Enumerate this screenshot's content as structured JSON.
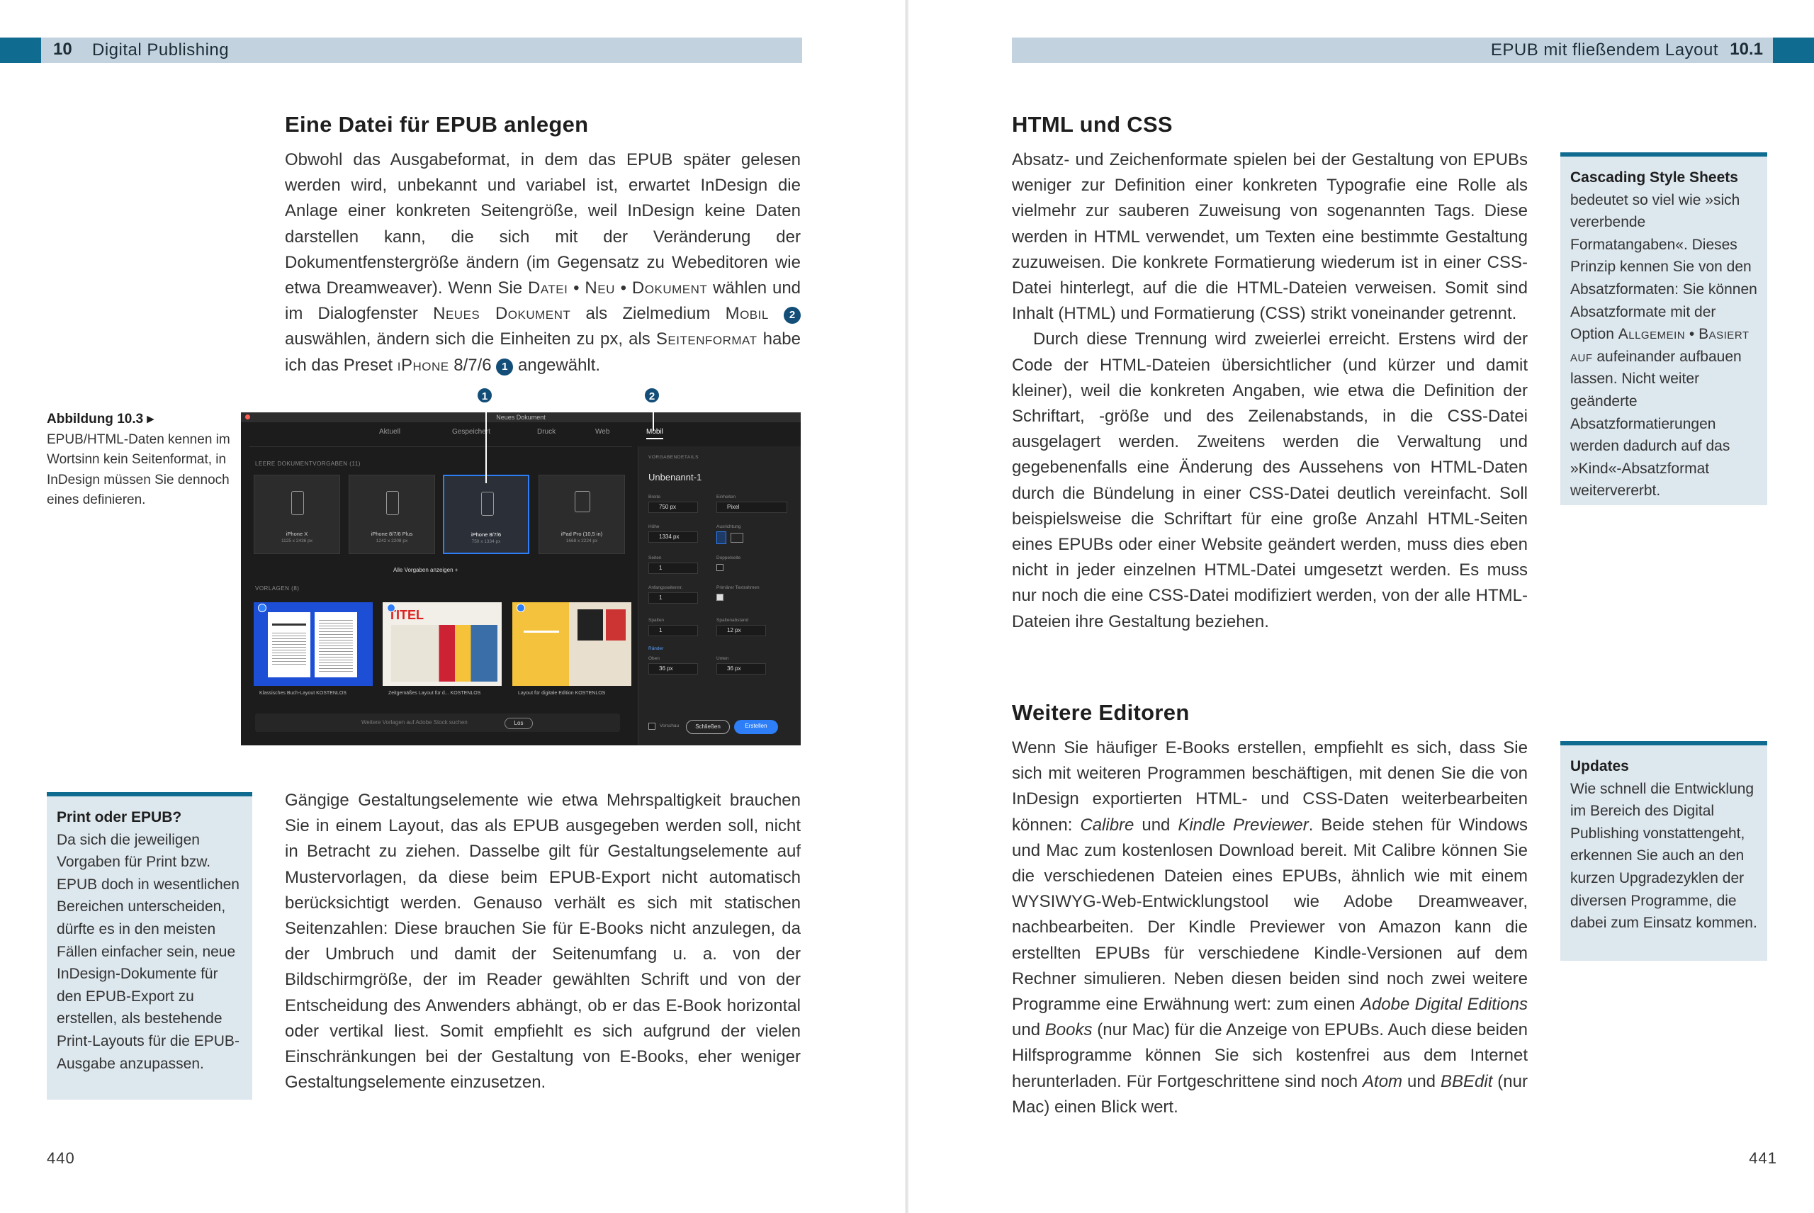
{
  "left_page": {
    "header": {
      "chapter_number": "10",
      "chapter_title": "Digital Publishing"
    },
    "folio": "440",
    "section_title": "Eine Datei für EPUB anlegen",
    "paragraph1": {
      "t1": "Obwohl das Ausgabeformat, in dem das EPUB später gelesen werden wird, unbekannt und variabel ist, erwartet InDesign die Anlage einer konkreten Seitengröße, weil InDesign keine Daten darstellen kann, die sich mit der Veränderung der Dokumentfenstergröße ändern (im Gegensatz zu Webeditoren wie etwa Dreamweaver). Wenn Sie ",
      "sc1": "Datei",
      "sep1": " • ",
      "sc2": "Neu",
      "sep2": " • ",
      "sc3": "Dokument",
      "t2": " wählen und im Dialogfenster ",
      "sc4": "Neues Dokument",
      "t3": " als Zielmedium ",
      "sc5": "Mobil",
      "callout2": "2",
      "t4": " auswählen, ändern sich die Einheiten zu px, als ",
      "sc6": "Seitenformat",
      "t5": " habe ich das Preset ",
      "sc7": "iPhone",
      "t6": " 8/7/6 ",
      "callout1": "1",
      "t7": " angewählt."
    },
    "figure_caption": {
      "title": "Abbildung 10.3 ▸",
      "text": "EPUB/HTML-Daten kennen im Wortsinn kein Seitenformat, in InDesign müssen Sie dennoch eines definieren."
    },
    "figure": {
      "window_title": "Neues Dokument",
      "tabs": [
        "Aktuell",
        "Gespeichert",
        "Druck",
        "Web",
        "Mobil"
      ],
      "active_tab": "Mobil",
      "presets_label": "LEERE DOKUMENTVORGABEN  (11)",
      "presets": [
        {
          "name": "iPhone X",
          "size": "1125 x 2436 px"
        },
        {
          "name": "iPhone 8/7/6 Plus",
          "size": "1242 x 2208 px"
        },
        {
          "name": "iPhone 8/7/6",
          "size": "750 x 1334 px"
        },
        {
          "name": "iPad Pro (10,5 in)",
          "size": "1668 x 2224 px"
        }
      ],
      "show_all": "Alle Vorgaben anzeigen  +",
      "templates_label": "VORLAGEN  (8)",
      "templates": [
        "Klassisches Buch-Layout  KOSTENLOS",
        "Zeitgemäßes Layout für d...  KOSTENLOS",
        "Layout für digitale Edition  KOSTENLOS"
      ],
      "search_placeholder": "Weitere Vorlagen auf Adobe Stock suchen",
      "search_button": "Los",
      "panel": {
        "header": "VORGABENDETAILS",
        "doc_name": "Unbenannt-1",
        "width_label": "Breite",
        "width_value": "750 px",
        "unit_label": "Einheiten",
        "unit_value": "Pixel",
        "height_label": "Höhe",
        "height_value": "1334 px",
        "orientation_label": "Ausrichtung",
        "pages_label": "Seiten",
        "pages_value": "1",
        "facing_label": "Doppelseite",
        "start_label": "Anfangsseitennr.",
        "start_value": "1",
        "primary_label": "Primärer Textrahmen",
        "columns_label": "Spalten",
        "columns_value": "1",
        "gutter_label": "Spaltenabstand",
        "gutter_value": "12 px",
        "margins_label": "Ränder",
        "top_label": "Oben",
        "top_value": "36 px",
        "bottom_label": "Unten",
        "bottom_value": "36 px",
        "preview_label": "Vorschau",
        "close_button": "Schließen",
        "create_button": "Erstellen"
      },
      "callout1": "1",
      "callout2": "2",
      "tpl_title": "TITEL"
    },
    "marginbox": {
      "title": "Print oder EPUB?",
      "text": "Da sich die jeweiligen Vorgaben für Print bzw. EPUB doch in wesentlichen Bereichen unterscheiden, dürfte es in den meisten Fällen einfacher sein, neue InDesign-Dokumente für den EPUB-Export zu erstellen, als bestehende Print-Layouts für die EPUB-Ausgabe anzupassen."
    },
    "paragraph2": "Gängige Gestaltungselemente wie etwa Mehrspaltigkeit brauchen Sie in einem Layout, das als EPUB ausgegeben werden soll, nicht in Betracht zu ziehen. Dasselbe gilt für Gestaltungselemente auf Mustervorlagen, da diese beim EPUB-Export nicht automatisch berücksichtigt werden. Genauso verhält es sich mit statischen Seitenzahlen: Diese brauchen Sie für E-Books nicht anzulegen, da der Umbruch und damit der Seitenumfang u. a. von der Bildschirmgröße, der im Reader gewählten Schrift und von der Entscheidung des Anwenders abhängt, ob er das E-Book horizontal oder vertikal liest. Somit empfiehlt es sich aufgrund der vielen Einschränkungen bei der Gestaltung von E-Books, eher weniger Gestaltungselemente einzusetzen."
  },
  "right_page": {
    "header": {
      "section_title": "EPUB mit fließendem Layout",
      "section_number": "10.1"
    },
    "folio": "441",
    "section1_title": "HTML und CSS",
    "section1_p1": "Absatz- und Zeichenformate spielen bei der Gestaltung von EPUBs weniger zur Definition einer konkreten Typografie eine Rolle als vielmehr zur sauberen Zuweisung von sogenannten Tags. Diese werden in HTML verwendet, um Texten eine bestimmte Gestaltung zuzuweisen. Die konkrete Formatierung wiederum ist in einer CSS-Datei hinterlegt, auf die die HTML-Dateien verweisen. Somit sind Inhalt (HTML) und Formatierung (CSS) strikt voneinander getrennt.",
    "section1_p2": "Durch diese Trennung wird zweierlei erreicht. Erstens wird der Code der HTML-Dateien übersichtlicher (und kürzer und damit kleiner), weil die konkreten Angaben, wie etwa die Definition der Schriftart, -größe und des Zeilenabstands, in die CSS-Datei ausgelagert werden. Zweitens werden die Verwaltung und gegebenenfalls eine Änderung des Aussehens von HTML-Daten durch die Bündelung in einer CSS-Datei deutlich vereinfacht. Soll beispielsweise die Schriftart für eine große Anzahl HTML-Seiten eines EPUBs oder einer Website geändert werden, muss dies eben nicht in jeder einzelnen HTML-Datei umgesetzt werden. Es muss nur noch die eine CSS-Datei modifiziert werden, von der alle HTML-Dateien ihre Gestaltung beziehen.",
    "section2_title": "Weitere Editoren",
    "section2_p": {
      "t1": "Wenn Sie häufiger E-Books erstellen, empfiehlt es sich, dass Sie sich mit weiteren Programmen beschäftigen, mit denen Sie die von InDesign exportierten HTML- und CSS-Daten weiterbearbeiten können: ",
      "e1": "Calibre",
      "t2": " und ",
      "e2": "Kindle Previewer",
      "t3": ". Beide stehen für Windows und Mac zum kostenlosen Download bereit. Mit Calibre können Sie die verschiedenen Dateien eines EPUBs, ähnlich wie mit einem WYSIWYG-Web-Entwicklungstool wie Adobe Dreamweaver, nachbearbeiten. Der Kindle Previewer von Amazon kann die erstellten EPUBs für verschiedene Kindle-Versionen auf dem Rechner simulieren. Neben diesen beiden sind noch zwei weitere Programme eine Erwähnung wert: zum einen ",
      "e3": "Adobe Digital Editions",
      "t4": " und ",
      "e4": "Books",
      "t5": " (nur Mac) für die Anzeige von EPUBs. Auch diese beiden Hilfsprogramme können Sie sich kostenfrei aus dem Internet herunterladen. Für Fortgeschrittene sind noch ",
      "e5": "Atom",
      "t6": " und ",
      "e6": "BBEdit",
      "t7": " (nur Mac) einen Blick wert."
    },
    "marginbox1": {
      "title": "Cascading Style Sheets",
      "t1": "bedeutet so viel wie »sich vererbende Formatangaben«. Dieses Prinzip kennen Sie von den Absatzformaten: Sie können Absatzformate mit der Option ",
      "sc1": "Allgemein",
      "sep": " • ",
      "sc2": "Basiert auf",
      "t2": " aufeinander aufbauen lassen. Nicht weiter geänderte Absatzformatierungen werden dadurch auf das »Kind«-Absatzformat weitervererbt."
    },
    "marginbox2": {
      "title": "Updates",
      "text": "Wie schnell die Entwicklung im Bereich des Digital Publishing vonstattengeht, erkennen Sie auch an den kurzen Upgradezyklen der diversen Programme, die dabei zum Einsatz kommen."
    }
  },
  "colors": {
    "header_band": "#c2d3df",
    "accent_blue": "#0f6b8f",
    "callout_blue": "#124e78",
    "marginbox_bg": "#dde7ee"
  }
}
